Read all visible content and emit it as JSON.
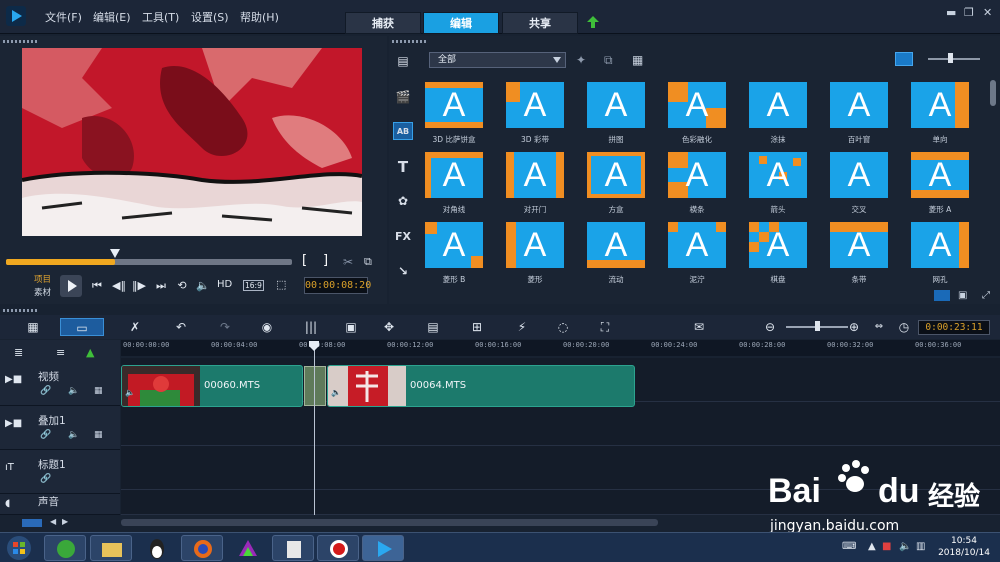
{
  "menu": {
    "file": "文件(F)",
    "edit": "编辑(E)",
    "tools": "工具(T)",
    "settings": "设置(S)",
    "help": "帮助(H)"
  },
  "mode_tabs": [
    "捕获",
    "编辑",
    "共享"
  ],
  "player": {
    "project_label": "项目",
    "clip_label": "素材",
    "hd_label": "HD",
    "aspect": "16:9",
    "timecode": "00:00:08:20",
    "scrub_progress": 0.38
  },
  "library": {
    "filter": "全部",
    "thumbs": [
      "3D 比萨饼盒",
      "3D 彩带",
      "拼图",
      "色彩融化",
      "涂抹",
      "百叶窗",
      "单向",
      "对角线",
      "对开门",
      "方盒",
      "横条",
      "箭头",
      "交叉",
      "菱形 A",
      "菱形 B",
      "菱形",
      "流动",
      "泥泞",
      "棋盘",
      "条带",
      "网孔"
    ]
  },
  "timeline": {
    "timecode": "0:00:23:11",
    "ruler": [
      "00:00:00:00",
      "00:00:04:00",
      "00:00:08:00",
      "00:00:12:00",
      "00:00:16:00",
      "00:00:20:00",
      "00:00:24:00",
      "00:00:28:00",
      "00:00:32:00",
      "00:00:36:00"
    ],
    "tracks": [
      "视频",
      "叠加1",
      "标题1",
      "声音"
    ],
    "clips": [
      {
        "name": "00060.MTS"
      },
      {
        "name": "00064.MTS"
      }
    ]
  },
  "taskbar": {
    "time": "10:54",
    "date": "2018/10/14"
  },
  "watermark": {
    "brand": "Bai",
    "brand2": "du",
    "brand3": "经验",
    "url": "jingyan.baidu.com"
  },
  "colors": {
    "accent": "#1aa0e2",
    "timecode": "#d9a02a",
    "clip": "#1c7a6c",
    "scrub": "#f0a820"
  }
}
